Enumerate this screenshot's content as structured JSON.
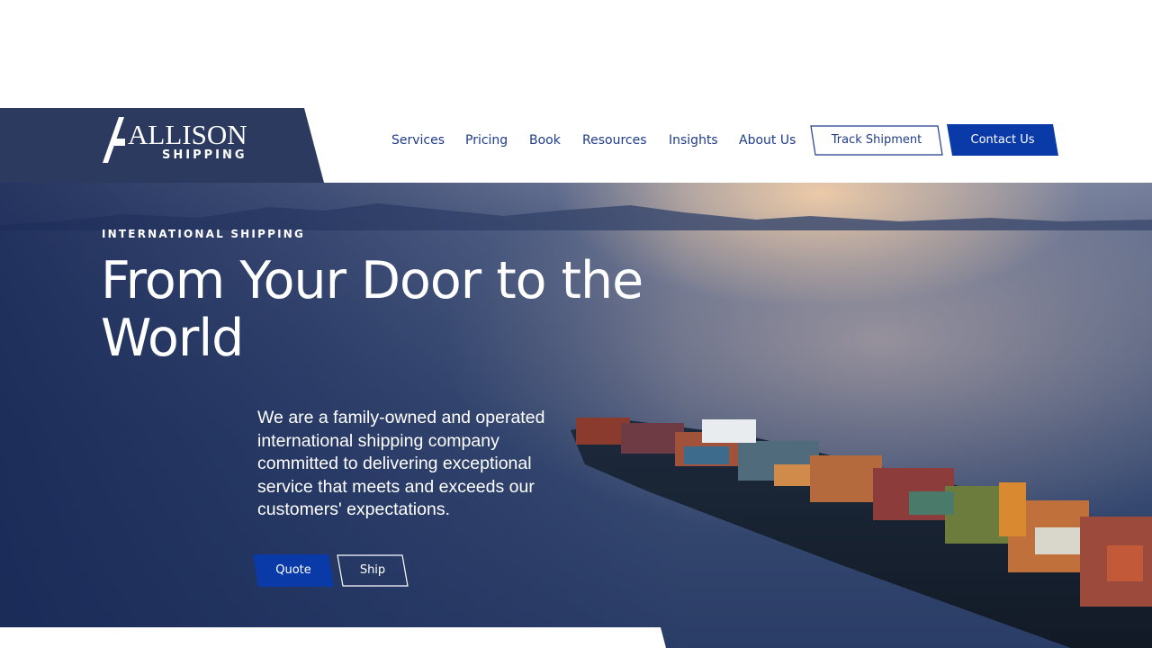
{
  "brand": {
    "name": "ALLISON",
    "sub": "SHIPPING"
  },
  "nav": {
    "items": [
      {
        "label": "Services"
      },
      {
        "label": "Pricing"
      },
      {
        "label": "Book"
      },
      {
        "label": "Resources"
      },
      {
        "label": "Insights"
      },
      {
        "label": "About Us"
      }
    ],
    "track_label": "Track Shipment",
    "contact_label": "Contact Us"
  },
  "hero": {
    "eyebrow": "INTERNATIONAL SHIPPING",
    "headline": "From Your Door to the World",
    "intro": "We are a family-owned and operated international shipping company committed to delivering exceptional service that meets and exceeds our customers' expectations.",
    "quote_label": "Quote",
    "ship_label": "Ship"
  },
  "colors": {
    "accent": "#0a3aa8",
    "nav_text": "#1f3c8a",
    "logo_panel": "#2b3a5e"
  }
}
